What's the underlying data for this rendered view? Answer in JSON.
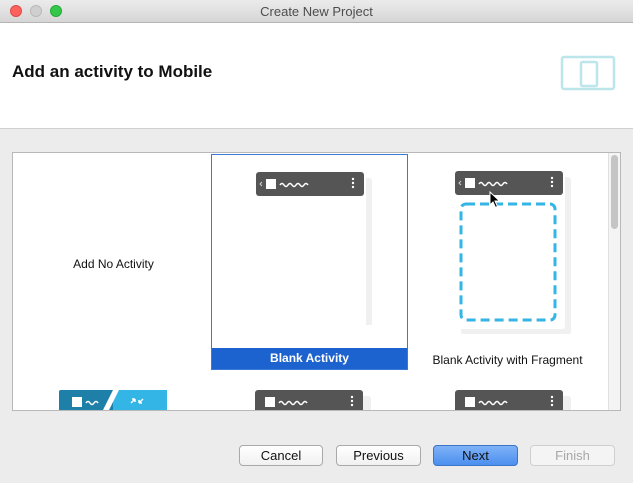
{
  "window": {
    "title": "Create New Project"
  },
  "header": {
    "heading": "Add an activity to Mobile"
  },
  "gallery": {
    "items": [
      {
        "label": "Add No Activity"
      },
      {
        "label": "Blank Activity",
        "selected": true
      },
      {
        "label": "Blank Activity with Fragment"
      }
    ]
  },
  "buttons": {
    "cancel": "Cancel",
    "previous": "Previous",
    "next": "Next",
    "finish": "Finish"
  },
  "colors": {
    "selection": "#1d63cf",
    "toolbar": "#555555",
    "fragment_outline": "#33b5e5",
    "device_icon": "#bde6ea"
  }
}
